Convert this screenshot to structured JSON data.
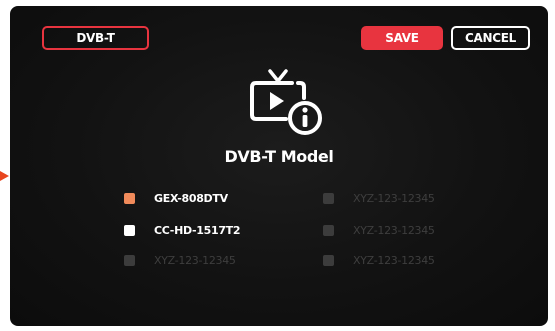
{
  "header": {
    "mode_tab_label": "DVB-T",
    "save_label": "SAVE",
    "cancel_label": "CANCEL"
  },
  "title": "DVB-T Model",
  "models": {
    "left": [
      {
        "label": "GEX-808DTV",
        "state": "selected"
      },
      {
        "label": "CC-HD-1517T2",
        "state": "enabled"
      },
      {
        "label": "XYZ-123-12345",
        "state": "disabled"
      }
    ],
    "right": [
      {
        "label": "XYZ-123-12345",
        "state": "disabled"
      },
      {
        "label": "XYZ-123-12345",
        "state": "disabled"
      },
      {
        "label": "XYZ-123-12345",
        "state": "disabled"
      }
    ]
  },
  "colors": {
    "accent_red": "#e8343f",
    "selected_checkbox": "#f08a5a",
    "screen_background": "#141414",
    "disabled": "#3e3e3e"
  },
  "icons": {
    "center_icon": "tv-play-info-icon",
    "side_pointer": "arrow-right-icon"
  }
}
